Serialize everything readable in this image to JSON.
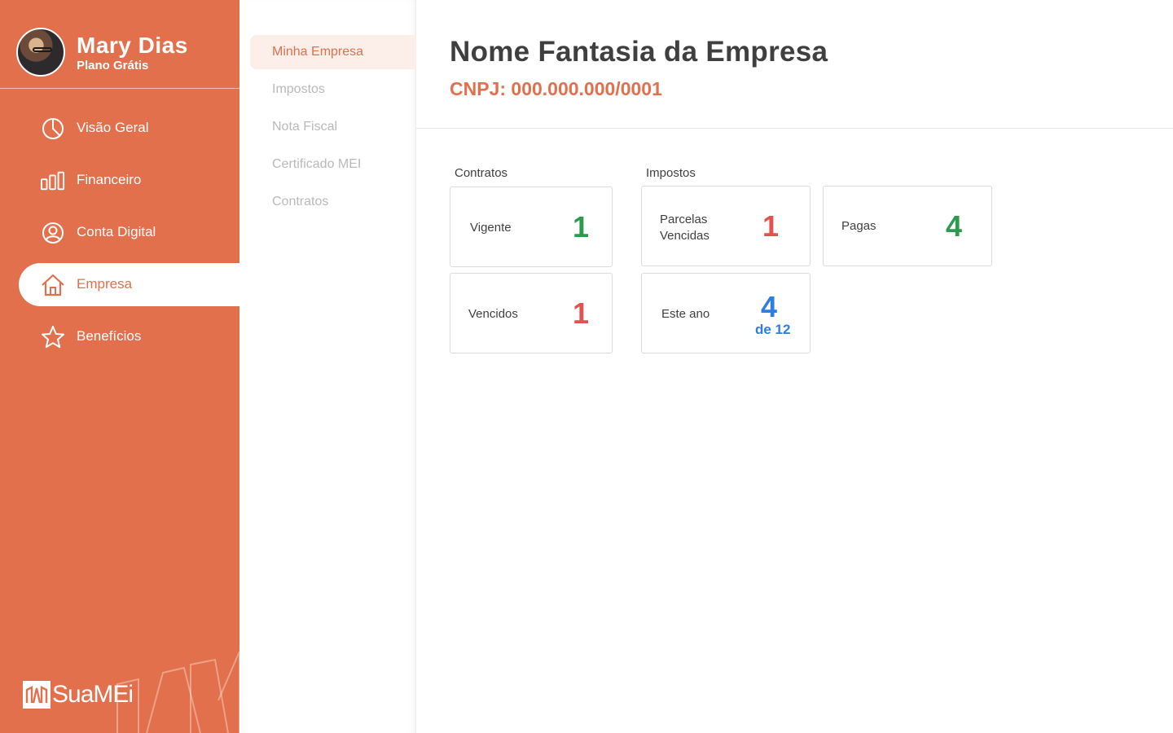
{
  "user": {
    "name": "Mary Dias",
    "plan": "Plano Grátis"
  },
  "sidebar": {
    "items": [
      {
        "label": "Visão Geral",
        "icon": "pie-chart-icon"
      },
      {
        "label": "Financeiro",
        "icon": "bar-chart-icon"
      },
      {
        "label": "Conta Digital",
        "icon": "user-circle-icon"
      },
      {
        "label": "Empresa",
        "icon": "home-icon",
        "active": true
      },
      {
        "label": "Benefícios",
        "icon": "star-icon"
      }
    ],
    "brand": "SuaMEi"
  },
  "submenu": {
    "items": [
      {
        "label": "Minha Empresa",
        "active": true
      },
      {
        "label": "Impostos"
      },
      {
        "label": "Nota Fiscal"
      },
      {
        "label": "Certificado MEI"
      },
      {
        "label": "Contratos"
      }
    ]
  },
  "header": {
    "title": "Nome Fantasia da Empresa",
    "cnpj": "CNPJ: 000.000.000/0001"
  },
  "contratos": {
    "title": "Contratos",
    "vigente": {
      "label": "Vigente",
      "value": "1"
    },
    "vencidos": {
      "label": "Vencidos",
      "value": "1"
    }
  },
  "impostos": {
    "title": "Impostos",
    "parcelas": {
      "label_line1": "Parcelas",
      "label_line2": "Vencidas",
      "value": "1"
    },
    "pagas": {
      "label": "Pagas",
      "value": "4"
    },
    "este_ano": {
      "label": "Este ano",
      "value": "4",
      "sub": "de 12"
    }
  },
  "colors": {
    "brand": "#e2704c",
    "positive": "#2e9a4e",
    "negative": "#e0534f",
    "info": "#2f7de1"
  }
}
